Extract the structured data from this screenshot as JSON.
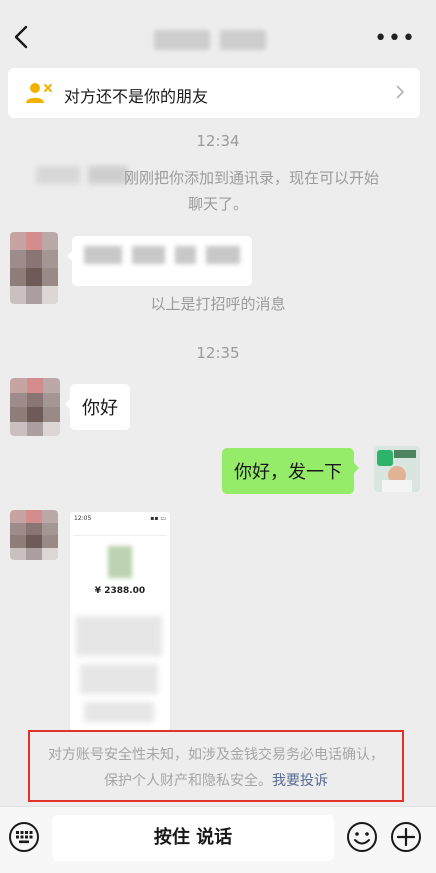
{
  "header": {
    "back_icon": "chevron-left-icon",
    "more_label": "•••"
  },
  "notice": {
    "icon": "user-x-icon",
    "text": "对方还不是你的朋友"
  },
  "chat": {
    "time1": "12:34",
    "system_added_line1": "刚刚把你添加到通讯录，现在可以开始",
    "system_added_line2": "聊天了。",
    "greeting_note": "以上是打招呼的消息",
    "time2": "12:35",
    "msg_hello": "你好",
    "msg_send": "你好，发一下",
    "payment_amount": "¥ 2388.00",
    "screenshot_time": "12:05"
  },
  "warning": {
    "line1": "对方账号安全性未知，如涉及金钱交易务必电话确认，",
    "line2_prefix": "保护个人财产和隐私安全。",
    "link": "我要投诉",
    "border_color": "#e0322a"
  },
  "input_bar": {
    "hold_label": "按住 说话",
    "voice_icon": "keyboard-icon",
    "emoji_icon": "emoji-icon",
    "plus_icon": "plus-circle-icon"
  },
  "colors": {
    "background": "#ededed",
    "self_bubble": "#95ec69",
    "link": "#576b95"
  }
}
